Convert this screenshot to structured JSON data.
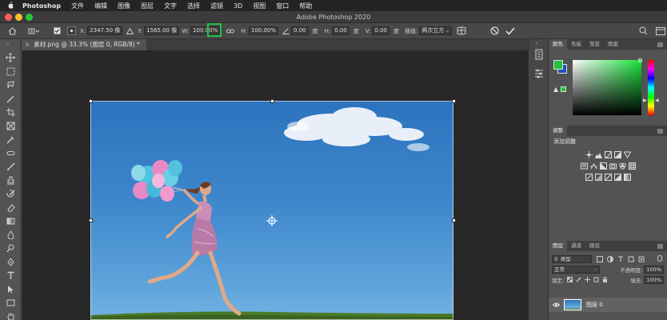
{
  "menubar": {
    "items": [
      "Photoshop",
      "文件",
      "编辑",
      "图像",
      "图层",
      "文字",
      "选择",
      "滤镜",
      "3D",
      "视图",
      "窗口",
      "帮助"
    ]
  },
  "window": {
    "title": "Adobe Photoshop 2020"
  },
  "options": {
    "x_label": "X:",
    "x_value": "2347.50 像",
    "y_label": "Y:",
    "y_value": "1565.00 像",
    "w_label": "W:",
    "w_value": "100.00%",
    "h_label": "H:",
    "h_value": "100.00%",
    "angle_value": "0.00",
    "angle_unit": "度",
    "hskew_label": "H:",
    "hskew_value": "0.00",
    "hskew_unit": "度",
    "vskew_label": "V:",
    "vskew_value": "0.00",
    "vskew_unit": "度",
    "interp_label": "插值:",
    "interp_value": "两次立方"
  },
  "document": {
    "tab_label": "素材.png @ 33.3% (图层 0, RGB/8) *"
  },
  "panels": {
    "color_tabs": [
      "颜色",
      "色板",
      "渐变",
      "图案"
    ],
    "adjust_tab": "调整",
    "adjust_add": "添加调整",
    "layers_tabs": [
      "图层",
      "通道",
      "路径"
    ],
    "kind_label": "类型",
    "blend_mode": "正常",
    "opacity_label": "不透明度:",
    "opacity_value": "100%",
    "lock_label": "锁定:",
    "fill_label": "填充:",
    "fill_value": "100%",
    "layer_name": "图层 0"
  },
  "colors": {
    "foreground": "#22c33a",
    "background": "#1f4fc0",
    "highlight": "#21c64a"
  }
}
